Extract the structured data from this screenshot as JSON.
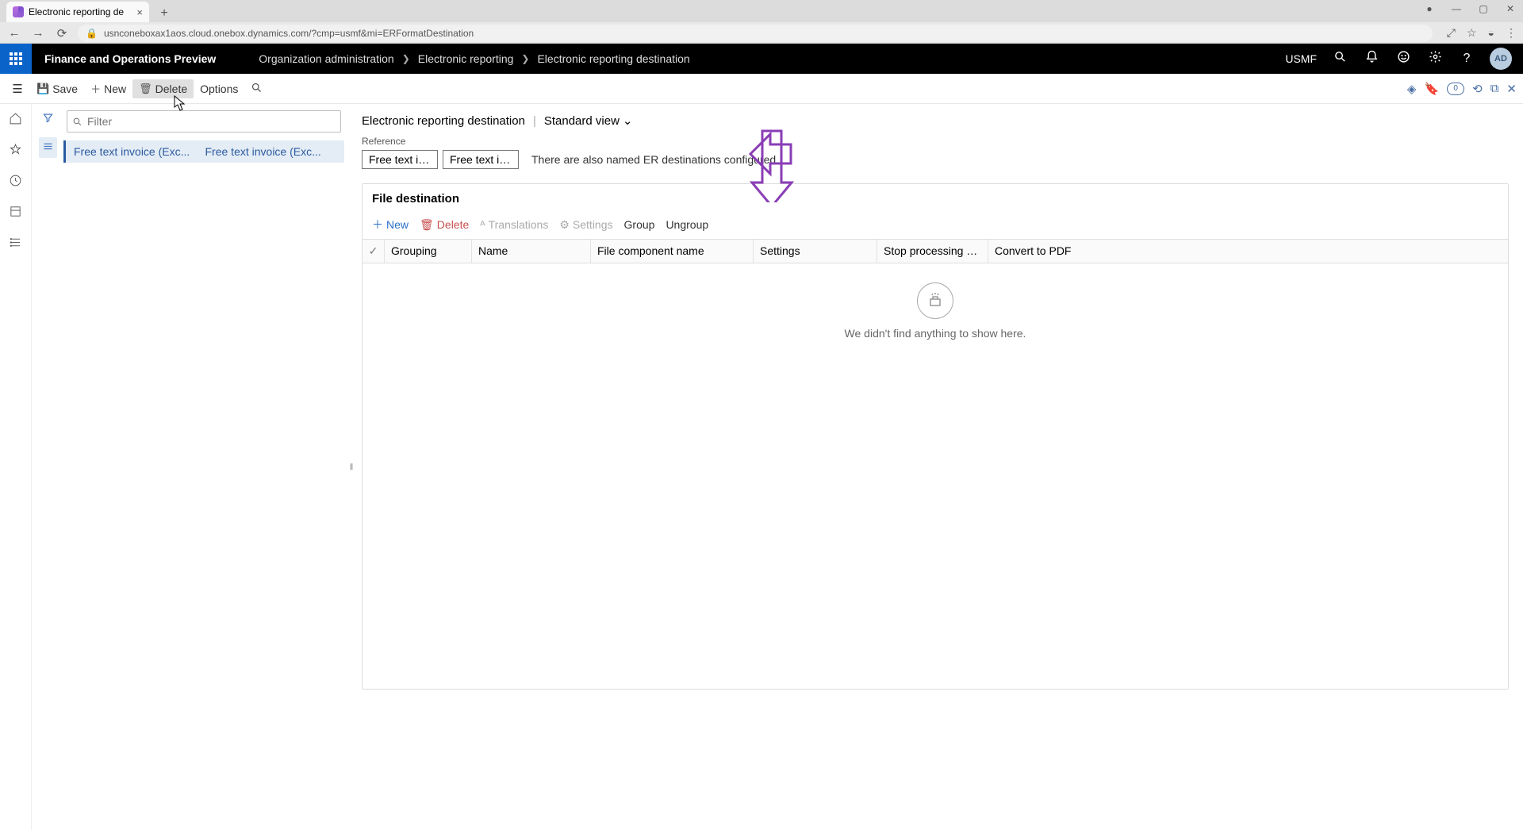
{
  "browser": {
    "tab_title": "Electronic reporting de",
    "url": "usnconeboxax1aos.cloud.onebox.dynamics.com/?cmp=usmf&mi=ERFormatDestination"
  },
  "header": {
    "app_title": "Finance and Operations Preview",
    "crumbs": [
      "Organization administration",
      "Electronic reporting",
      "Electronic reporting destination"
    ],
    "company": "USMF",
    "user_initials": "AD"
  },
  "toolbar": {
    "save": "Save",
    "new": "New",
    "delete": "Delete",
    "options": "Options",
    "badge": "0"
  },
  "list": {
    "filter_placeholder": "Filter",
    "rows": [
      {
        "c1": "Free text invoice (Exc...",
        "c2": "Free text invoice (Exc..."
      }
    ]
  },
  "detail": {
    "title": "Electronic reporting destination",
    "view": "Standard view",
    "ref_label": "Reference",
    "ref_chip1": "Free text inv...",
    "ref_chip2": "Free text inv...",
    "ref_note": "There are also named ER destinations configured.",
    "section_title": "File destination",
    "sec_toolbar": {
      "new": "New",
      "delete": "Delete",
      "translations": "Translations",
      "settings": "Settings",
      "group": "Group",
      "ungroup": "Ungroup"
    },
    "grid_headers": {
      "grouping": "Grouping",
      "name": "Name",
      "fcn": "File component name",
      "settings": "Settings",
      "stop": "Stop processing on …",
      "pdf": "Convert to PDF"
    },
    "empty_msg": "We didn't find anything to show here."
  }
}
